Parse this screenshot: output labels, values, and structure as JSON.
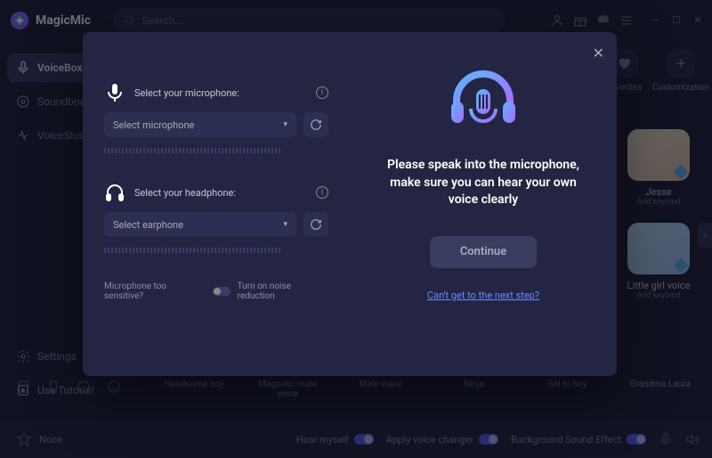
{
  "app": {
    "name": "MagicMic"
  },
  "search": {
    "placeholder": "Search..."
  },
  "sidebar": {
    "items": [
      {
        "label": "VoiceBox"
      },
      {
        "label": "Soundboard"
      },
      {
        "label": "VoiceStudio"
      }
    ],
    "bottom": [
      {
        "label": "Settings"
      },
      {
        "label": "Use Tutorial"
      }
    ]
  },
  "topRow": {
    "favorites": "Favorites",
    "customization": "Customization"
  },
  "voices": [
    {
      "name": "Jesse",
      "sub": "Add keybind"
    },
    {
      "name": "Little girl voice",
      "sub": "Add keybind"
    }
  ],
  "categories": [
    "Handsome boy",
    "Magnetic male voice",
    "Male voice",
    "Ninja",
    "Girl to boy",
    "Grandma Laura"
  ],
  "footer": {
    "none": "None",
    "hear": "Hear myself",
    "apply": "Apply voice changer",
    "bg": "Background Sound Effect"
  },
  "modal": {
    "micLabel": "Select your microphone:",
    "micPlaceholder": "Select microphone",
    "hpLabel": "Select your headphone:",
    "hpPlaceholder": "Select earphone",
    "noiseQ": "Microphone too sensitive?",
    "noiseA": "Turn on noise reduction",
    "speak": "Please speak into the microphone, make sure you can hear your own voice clearly",
    "continue": "Continue",
    "help": "Can't get to the next step?"
  }
}
